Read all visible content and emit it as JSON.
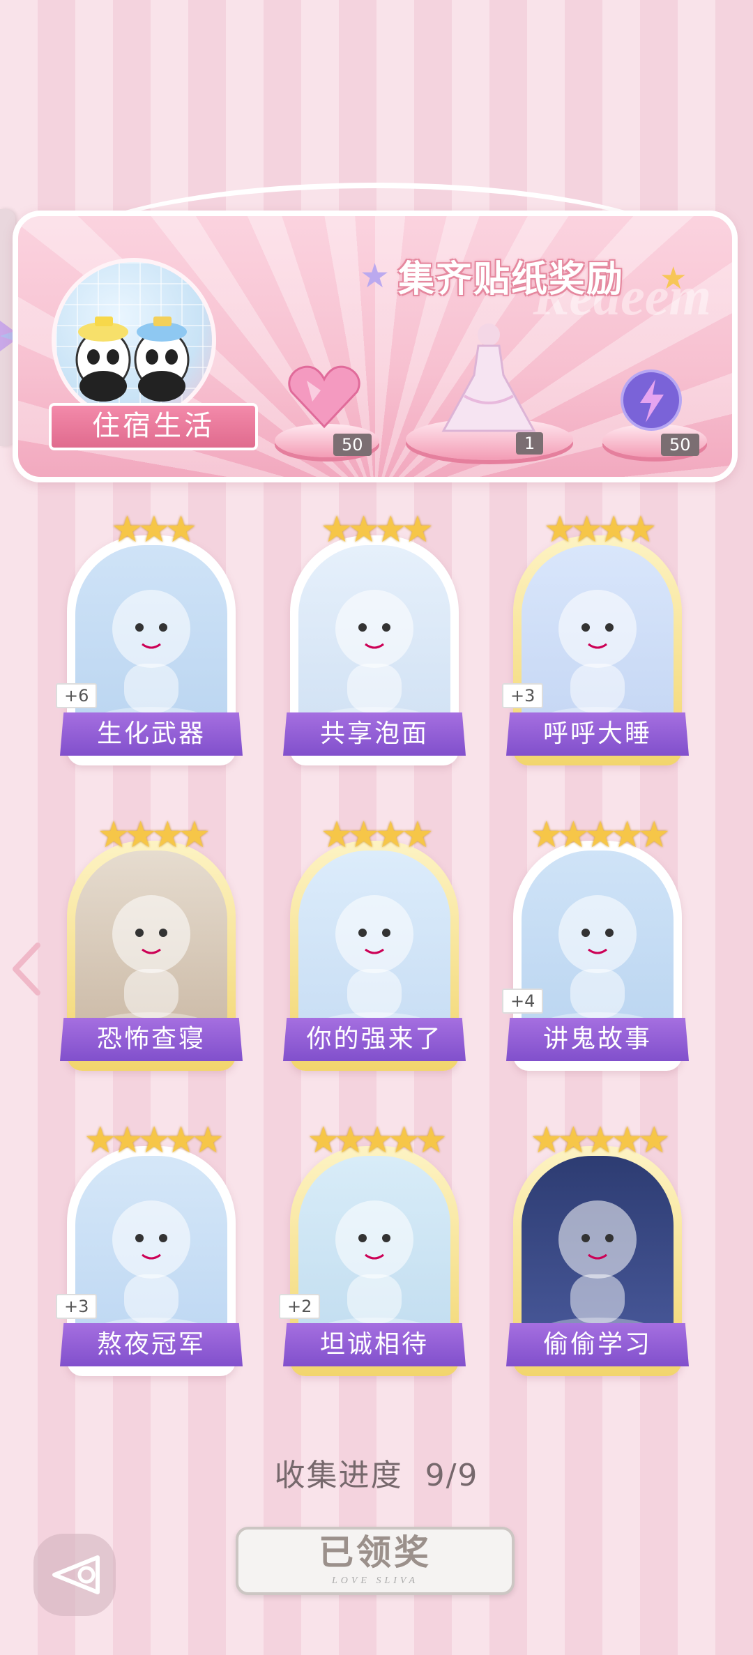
{
  "banner": {
    "title": "集齐贴纸奖励",
    "watermark": "Redeem",
    "theme_label": "住宿生活",
    "rewards": [
      {
        "icon": "heart-gem-icon",
        "count": "50"
      },
      {
        "icon": "dress-outfit-icon",
        "count": "1"
      },
      {
        "icon": "lightning-orb-icon",
        "count": "50"
      }
    ]
  },
  "cards": [
    {
      "label": "生化武器",
      "stars": 3,
      "bonus": "+6",
      "gold": false
    },
    {
      "label": "共享泡面",
      "stars": 4,
      "bonus": "",
      "gold": false
    },
    {
      "label": "呼呼大睡",
      "stars": 4,
      "bonus": "+3",
      "gold": true
    },
    {
      "label": "恐怖查寝",
      "stars": 4,
      "bonus": "",
      "gold": true
    },
    {
      "label": "你的强来了",
      "stars": 4,
      "bonus": "",
      "gold": true
    },
    {
      "label": "讲鬼故事",
      "stars": 5,
      "bonus": "+4",
      "gold": false
    },
    {
      "label": "熬夜冠军",
      "stars": 5,
      "bonus": "+3",
      "gold": false
    },
    {
      "label": "坦诚相待",
      "stars": 5,
      "bonus": "+2",
      "gold": true
    },
    {
      "label": "偷偷学习",
      "stars": 5,
      "bonus": "",
      "gold": true
    }
  ],
  "progress": {
    "label": "收集进度",
    "value": "9/9"
  },
  "claim_button": {
    "label": "已领奖",
    "sub": "LOVE SLIVA"
  },
  "colors": {
    "accent": "#8150cc",
    "banner_pink": "#f7c0d0",
    "star_gold": "#f6c648"
  }
}
